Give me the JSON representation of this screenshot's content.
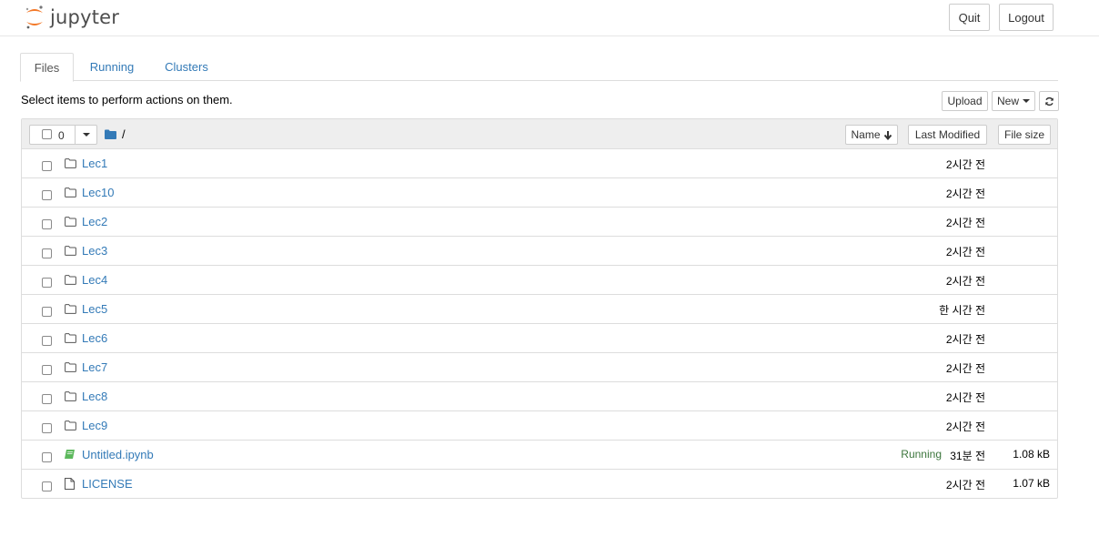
{
  "header": {
    "logo_text": "jupyter",
    "quit_label": "Quit",
    "logout_label": "Logout"
  },
  "tabs": [
    {
      "label": "Files",
      "active": true
    },
    {
      "label": "Running",
      "active": false
    },
    {
      "label": "Clusters",
      "active": false
    }
  ],
  "toolbar": {
    "hint": "Select items to perform actions on them.",
    "upload_label": "Upload",
    "new_label": "New",
    "refresh_icon": "refresh-icon"
  },
  "list": {
    "selected_count": "0",
    "breadcrumb": "/",
    "columns": {
      "name": "Name",
      "last_modified": "Last Modified",
      "file_size": "File size"
    },
    "items": [
      {
        "type": "folder",
        "name": "Lec1",
        "modified": "2시간 전",
        "size": "",
        "status": ""
      },
      {
        "type": "folder",
        "name": "Lec10",
        "modified": "2시간 전",
        "size": "",
        "status": ""
      },
      {
        "type": "folder",
        "name": "Lec2",
        "modified": "2시간 전",
        "size": "",
        "status": ""
      },
      {
        "type": "folder",
        "name": "Lec3",
        "modified": "2시간 전",
        "size": "",
        "status": ""
      },
      {
        "type": "folder",
        "name": "Lec4",
        "modified": "2시간 전",
        "size": "",
        "status": ""
      },
      {
        "type": "folder",
        "name": "Lec5",
        "modified": "한 시간 전",
        "size": "",
        "status": ""
      },
      {
        "type": "folder",
        "name": "Lec6",
        "modified": "2시간 전",
        "size": "",
        "status": ""
      },
      {
        "type": "folder",
        "name": "Lec7",
        "modified": "2시간 전",
        "size": "",
        "status": ""
      },
      {
        "type": "folder",
        "name": "Lec8",
        "modified": "2시간 전",
        "size": "",
        "status": ""
      },
      {
        "type": "folder",
        "name": "Lec9",
        "modified": "2시간 전",
        "size": "",
        "status": ""
      },
      {
        "type": "notebook",
        "name": "Untitled.ipynb",
        "modified": "31분 전",
        "size": "1.08 kB",
        "status": "Running"
      },
      {
        "type": "file",
        "name": "LICENSE",
        "modified": "2시간 전",
        "size": "1.07 kB",
        "status": ""
      }
    ]
  },
  "colors": {
    "link": "#337ab7",
    "running": "#3c763d",
    "jupyter_orange": "#f37726",
    "notebook_green": "#5cb85c"
  }
}
